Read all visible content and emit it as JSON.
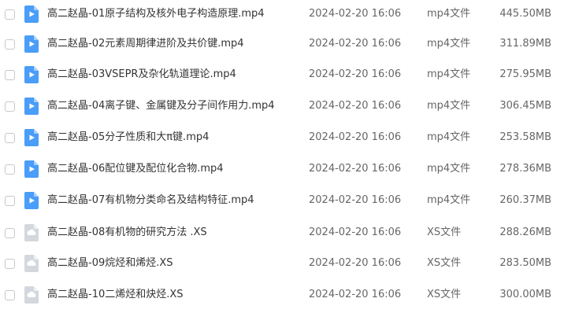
{
  "files": [
    {
      "name": "高二赵晶-01原子结构及核外电子构造原理.mp4",
      "date": "2024-02-20 16:06",
      "type": "mp4文件",
      "size": "445.50MB",
      "icon": "video-file-icon"
    },
    {
      "name": "高二赵晶-02元素周期律进阶及共价键.mp4",
      "date": "2024-02-20 16:06",
      "type": "mp4文件",
      "size": "311.89MB",
      "icon": "video-file-icon"
    },
    {
      "name": "高二赵晶-03VSEPR及杂化轨道理论.mp4",
      "date": "2024-02-20 16:06",
      "type": "mp4文件",
      "size": "275.95MB",
      "icon": "video-file-icon"
    },
    {
      "name": "高二赵晶-04离子键、金属键及分子间作用力.mp4",
      "date": "2024-02-20 16:06",
      "type": "mp4文件",
      "size": "306.45MB",
      "icon": "video-file-icon"
    },
    {
      "name": "高二赵晶-05分子性质和大π键.mp4",
      "date": "2024-02-20 16:06",
      "type": "mp4文件",
      "size": "253.58MB",
      "icon": "video-file-icon"
    },
    {
      "name": "高二赵晶-06配位键及配位化合物.mp4",
      "date": "2024-02-20 16:06",
      "type": "mp4文件",
      "size": "278.36MB",
      "icon": "video-file-icon"
    },
    {
      "name": "高二赵晶-07有机物分类命名及结构特征.mp4",
      "date": "2024-02-20 16:06",
      "type": "mp4文件",
      "size": "260.37MB",
      "icon": "video-file-icon"
    },
    {
      "name": "高二赵晶-08有机物的研究方法 .XS",
      "date": "2024-02-20 16:06",
      "type": "XS文件",
      "size": "288.26MB",
      "icon": "generic-file-icon"
    },
    {
      "name": "高二赵晶-09烷烃和烯烃.XS",
      "date": "2024-02-20 16:06",
      "type": "XS文件",
      "size": "283.50MB",
      "icon": "generic-file-icon"
    },
    {
      "name": "高二赵晶-10二烯烃和炔烃.XS",
      "date": "2024-02-20 16:06",
      "type": "XS文件",
      "size": "300.00MB",
      "icon": "generic-file-icon"
    }
  ],
  "colors": {
    "video_icon": "#4a9df8",
    "generic_icon": "#d4d8de",
    "text_primary": "#333333",
    "text_secondary": "#666666"
  }
}
